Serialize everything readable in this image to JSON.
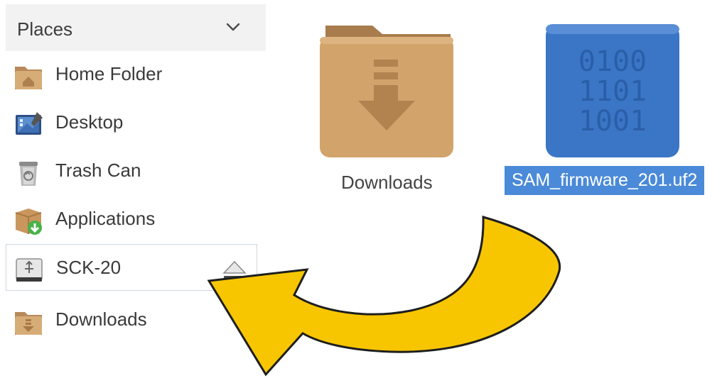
{
  "sidebar": {
    "header": "Places",
    "items": [
      {
        "label": "Home Folder",
        "icon": "home-folder-icon"
      },
      {
        "label": "Desktop",
        "icon": "desktop-icon"
      },
      {
        "label": "Trash Can",
        "icon": "trash-can-icon"
      },
      {
        "label": "Applications",
        "icon": "applications-icon"
      },
      {
        "label": "SCK-20",
        "icon": "usb-drive-icon",
        "selected": true
      },
      {
        "label": "Downloads",
        "icon": "downloads-folder-icon"
      }
    ]
  },
  "files": [
    {
      "name": "Downloads",
      "icon": "downloads-folder-icon"
    },
    {
      "name": "SAM_firmware_201.uf2",
      "icon": "binary-file-icon",
      "selected": true,
      "binary_rows": [
        "0100",
        "1101",
        "1001"
      ]
    }
  ],
  "colors": {
    "selection": "#4a8ad8",
    "folder": "#c9a06a",
    "binary_file": "#3e78c8",
    "arrow": "#f7c600"
  }
}
